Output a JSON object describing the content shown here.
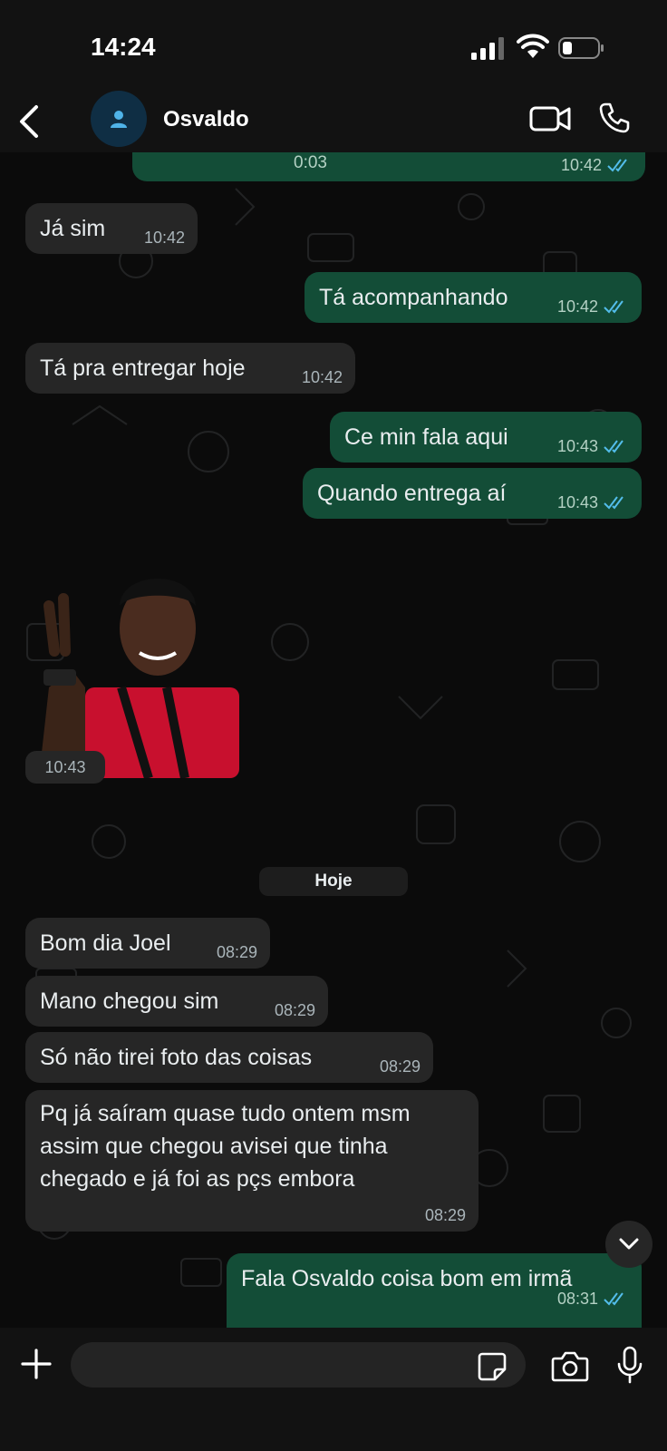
{
  "status_bar": {
    "time": "14:24"
  },
  "header": {
    "contact_name": "Osvaldo"
  },
  "messages": [
    {
      "text": "0:03",
      "time": "10:42"
    },
    {
      "text": "Já sim",
      "time": "10:42"
    },
    {
      "text": "Tá acompanhando",
      "time": "10:42"
    },
    {
      "text": "Tá pra entregar hoje",
      "time": "10:42"
    },
    {
      "text": "Ce min fala aqui",
      "time": "10:43"
    },
    {
      "text": "Quando entrega aí",
      "time": "10:43"
    },
    {
      "text": "",
      "time": "10:43"
    },
    {
      "text": "Bom dia Joel",
      "time": "08:29"
    },
    {
      "text": "Mano chegou sim",
      "time": "08:29"
    },
    {
      "text": "Só não tirei foto das coisas",
      "time": "08:29"
    },
    {
      "lines": [
        "Pq já saíram quase tudo ontem msm",
        "assim que chegou avisei que tinha",
        "chegado e já foi as pçs embora"
      ],
      "time": "08:29"
    },
    {
      "text": "Fala Osvaldo coisa bom em irmã",
      "time": "08:31"
    }
  ],
  "day_separator": "Hoje",
  "composer": {
    "placeholder": ""
  },
  "icons": {
    "back": "chevron-left-icon",
    "video": "video-call-icon",
    "phone": "phone-icon",
    "plus": "plus-icon",
    "sticker": "sticker-icon",
    "camera": "camera-icon",
    "mic": "microphone-icon",
    "scroll": "chevron-down-icon"
  },
  "colors": {
    "incoming_bubble": "#262626",
    "outgoing_bubble": "#134d37",
    "read_ticks": "#53bdeb",
    "background": "#0b0b0b"
  }
}
